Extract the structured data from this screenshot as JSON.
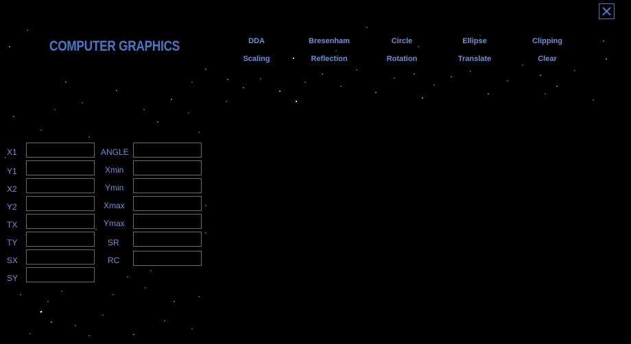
{
  "app": {
    "title": "COMPUTER GRAPHICS"
  },
  "window": {
    "close_icon": "close-icon"
  },
  "menu": {
    "row1": [
      "DDA",
      "Bresenham",
      "Circle",
      "Ellipse",
      "Clipping"
    ],
    "row2": [
      "Scaling",
      "Reflection",
      "Rotation",
      "Translate",
      "Clear"
    ]
  },
  "form": {
    "left": [
      {
        "label": "X1",
        "value": ""
      },
      {
        "label": "Y1",
        "value": ""
      },
      {
        "label": "X2",
        "value": ""
      },
      {
        "label": "Y2",
        "value": ""
      },
      {
        "label": "TX",
        "value": ""
      },
      {
        "label": "TY",
        "value": ""
      },
      {
        "label": "SX",
        "value": ""
      },
      {
        "label": "SY",
        "value": ""
      }
    ],
    "right": [
      {
        "label": "ANGLE",
        "value": ""
      },
      {
        "label": "Xmin",
        "value": ""
      },
      {
        "label": "Ymin",
        "value": ""
      },
      {
        "label": "Xmax",
        "value": ""
      },
      {
        "label": "Ymax",
        "value": ""
      },
      {
        "label": "SR",
        "value": ""
      },
      {
        "label": "RC",
        "value": ""
      }
    ]
  },
  "colors": {
    "accent": "#4a78c8",
    "label": "#6f90d8",
    "background": "#000000",
    "border": "#6b6b6b"
  }
}
